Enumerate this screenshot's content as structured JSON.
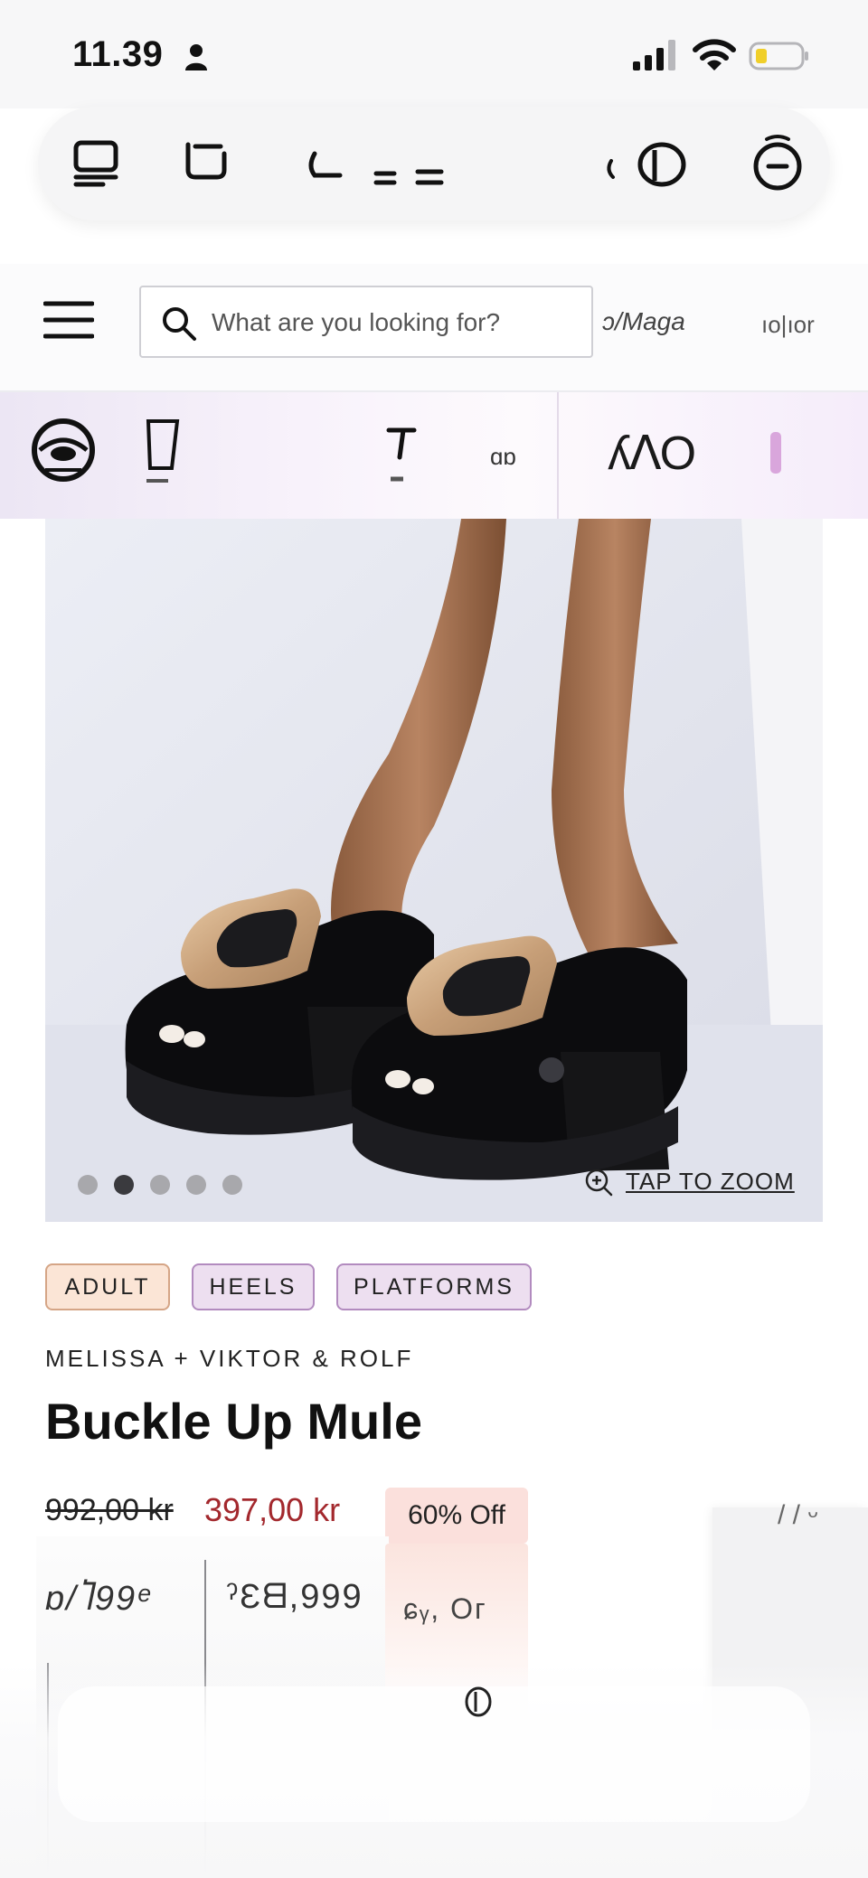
{
  "status_bar": {
    "time": "11.39",
    "icons": [
      "person-icon",
      "signal-icon",
      "wifi-icon",
      "battery-icon"
    ]
  },
  "browser_toolbar": {
    "icons": [
      "tabs-icon",
      "bookmark-icon",
      "reader-icon",
      "share-icon",
      "more-icon"
    ]
  },
  "header": {
    "menu_icon": "hamburger-menu-icon",
    "search": {
      "placeholder": "What are you looking for?",
      "icon": "search-icon"
    },
    "right_text_a": "ɔ/Maga",
    "right_text_b": "ıo|ıor"
  },
  "category_strip": {
    "icons": [
      "eye-category-icon",
      "box-category-icon",
      "figure-category-icon",
      "text-category-icon",
      "shape-category-icon",
      "accent-category-icon"
    ],
    "fragment_text": "ɑɒ",
    "fragment_text_2": "ʎᐱO"
  },
  "product": {
    "image_alt": "Black patent platform mules with oversized gold buckle",
    "carousel": {
      "count": 5,
      "active_index": 1
    },
    "zoom_label": "TAP TO ZOOM",
    "tags": [
      "ADULT",
      "HEELS",
      "PLATFORMS"
    ],
    "brand": "MELISSA + VIKTOR & ROLF",
    "title": "Buckle Up Mule",
    "old_price": "992,00 kr",
    "sale_price": "397,00 kr",
    "discount": "60% Off"
  },
  "ghost_overlay": {
    "text_1": "ɒ/Ⴈ99ᵉ",
    "text_2": "ˀƐᗺ,999",
    "text_3": "ɕᵧ, Oᴦ",
    "text_4": "/ / ᵕ"
  },
  "colors": {
    "sale_price": "#a3282d",
    "tag_adult_bg": "#fbe5d6",
    "tag_adult_border": "#d5a586",
    "tag_category_bg": "#eddff0",
    "tag_category_border": "#b28bbf",
    "discount_bg": "#fbe0dc"
  }
}
